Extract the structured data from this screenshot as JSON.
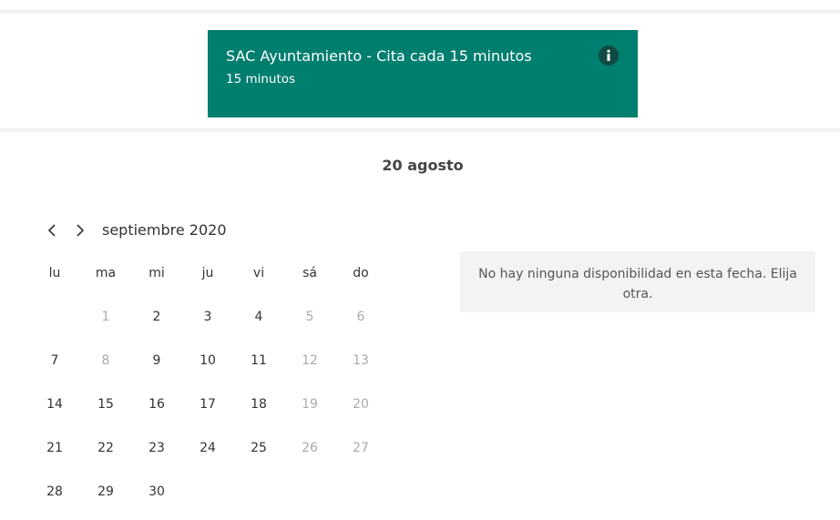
{
  "theme": {
    "accent": "#007e6e",
    "info_icon_bg": "#0e4a42"
  },
  "service": {
    "title": "SAC Ayuntamiento - Cita cada 15 minutos",
    "duration": "15 minutos",
    "info_icon": "info-icon"
  },
  "selected_date": "20 agosto",
  "calendar": {
    "prev_icon": "chevron-left-icon",
    "next_icon": "chevron-right-icon",
    "month_label": "septiembre 2020",
    "weekdays": [
      "lu",
      "ma",
      "mi",
      "ju",
      "vi",
      "sá",
      "do"
    ],
    "start_weekday": 1,
    "days": [
      {
        "label": "1",
        "available": false
      },
      {
        "label": "2",
        "available": true
      },
      {
        "label": "3",
        "available": true
      },
      {
        "label": "4",
        "available": true
      },
      {
        "label": "5",
        "available": false
      },
      {
        "label": "6",
        "available": false
      },
      {
        "label": "7",
        "available": true
      },
      {
        "label": "8",
        "available": false
      },
      {
        "label": "9",
        "available": true
      },
      {
        "label": "10",
        "available": true
      },
      {
        "label": "11",
        "available": true
      },
      {
        "label": "12",
        "available": false
      },
      {
        "label": "13",
        "available": false
      },
      {
        "label": "14",
        "available": true
      },
      {
        "label": "15",
        "available": true
      },
      {
        "label": "16",
        "available": true
      },
      {
        "label": "17",
        "available": true
      },
      {
        "label": "18",
        "available": true
      },
      {
        "label": "19",
        "available": false
      },
      {
        "label": "20",
        "available": false
      },
      {
        "label": "21",
        "available": true
      },
      {
        "label": "22",
        "available": true
      },
      {
        "label": "23",
        "available": true
      },
      {
        "label": "24",
        "available": true
      },
      {
        "label": "25",
        "available": true
      },
      {
        "label": "26",
        "available": false
      },
      {
        "label": "27",
        "available": false
      },
      {
        "label": "28",
        "available": true
      },
      {
        "label": "29",
        "available": true
      },
      {
        "label": "30",
        "available": true
      }
    ]
  },
  "availability_message": "No hay ninguna disponibilidad en esta fecha. Elija otra."
}
